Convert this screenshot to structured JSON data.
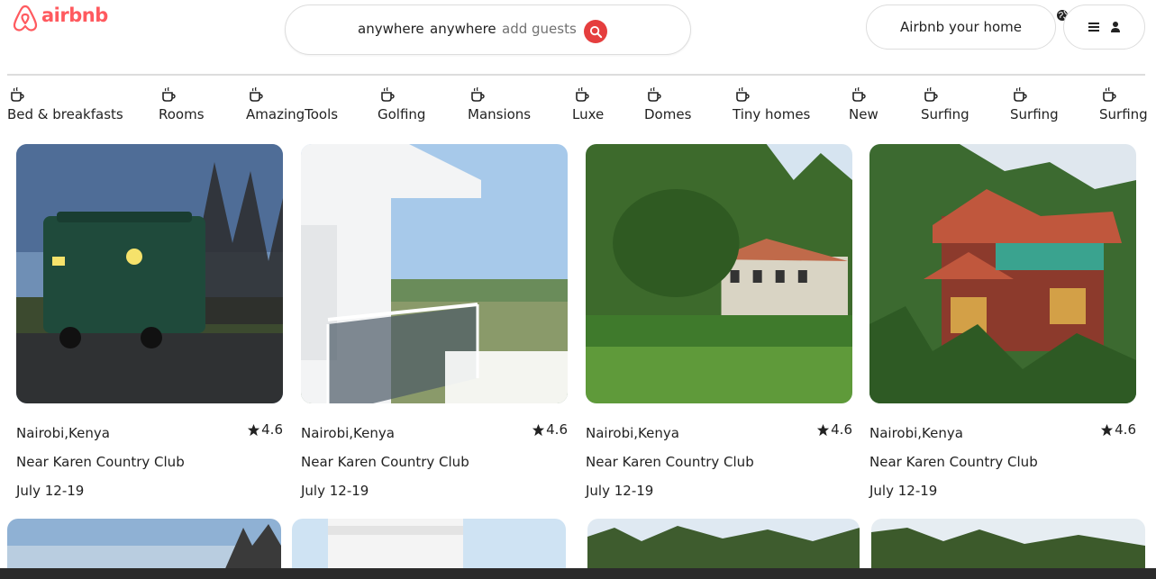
{
  "brand": {
    "name": "airbnb",
    "color": "#ff5a5f",
    "icon": "airbnb-logo-icon"
  },
  "search": {
    "location": "anywhere",
    "dates": "anywhere",
    "guests_placeholder": "add guests",
    "button_icon": "search-icon",
    "button_color": "#e53e3e"
  },
  "header": {
    "host_label": "Airbnb your home",
    "globe_icon": "globe-icon",
    "menu_icon": "hamburger-menu-icon",
    "user_icon": "user-icon"
  },
  "categories": [
    {
      "label": "Bed & breakfasts",
      "icon": "coffee-cup-icon"
    },
    {
      "label": "Rooms",
      "icon": "coffee-cup-icon"
    },
    {
      "label": "AmazingTools",
      "icon": "coffee-cup-icon"
    },
    {
      "label": "Golfing",
      "icon": "coffee-cup-icon"
    },
    {
      "label": "Mansions",
      "icon": "coffee-cup-icon"
    },
    {
      "label": "Luxe",
      "icon": "coffee-cup-icon"
    },
    {
      "label": "Domes",
      "icon": "coffee-cup-icon"
    },
    {
      "label": "Tiny homes",
      "icon": "coffee-cup-icon"
    },
    {
      "label": "New",
      "icon": "coffee-cup-icon"
    },
    {
      "label": "Surfing",
      "icon": "coffee-cup-icon"
    },
    {
      "label": "Surfing",
      "icon": "coffee-cup-icon"
    },
    {
      "label": "Surfing",
      "icon": "coffee-cup-icon"
    }
  ],
  "listings": [
    {
      "location": "Nairobi,Kenya",
      "rating": "4.6",
      "title": "Near Karen Country Club",
      "dates": "July 12-19",
      "photo": "green-caravan-at-dusk"
    },
    {
      "location": "Nairobi,Kenya",
      "rating": "4.6",
      "title": "Near Karen Country Club",
      "dates": "July 12-19",
      "photo": "white-balcony-lake-view"
    },
    {
      "location": "Nairobi,Kenya",
      "rating": "4.6",
      "title": "Near Karen Country Club",
      "dates": "July 12-19",
      "photo": "cottage-with-lawn-and-trees"
    },
    {
      "location": "Nairobi,Kenya",
      "rating": "4.6",
      "title": "Near Karen Country Club",
      "dates": "July 12-19",
      "photo": "red-roof-villa-in-forest"
    }
  ]
}
